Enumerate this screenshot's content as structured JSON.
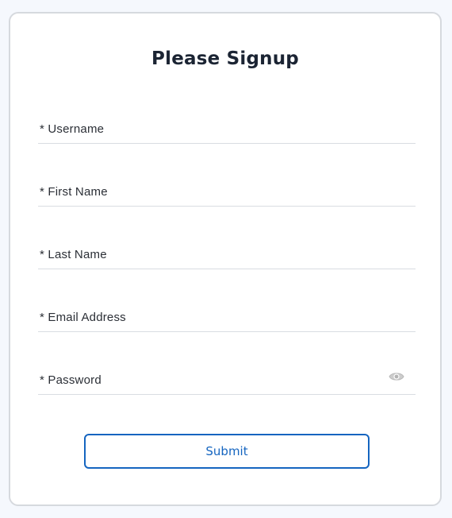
{
  "form": {
    "title": "Please Signup",
    "fields": [
      {
        "label": "* Username",
        "value": "",
        "type": "text"
      },
      {
        "label": "* First Name",
        "value": "",
        "type": "text"
      },
      {
        "label": "* Last Name",
        "value": "",
        "type": "text"
      },
      {
        "label": "* Email Address",
        "value": "",
        "type": "email"
      },
      {
        "label": "* Password",
        "value": "",
        "type": "password"
      }
    ],
    "password_toggle_icon": "eye-icon",
    "submit_label": "Submit",
    "colors": {
      "accent": "#1565c0",
      "title": "#1b2433",
      "background": "#f5f8fd",
      "card": "#ffffff",
      "card_border": "#d6d9de",
      "eye_icon": "#b9b9b9"
    }
  }
}
